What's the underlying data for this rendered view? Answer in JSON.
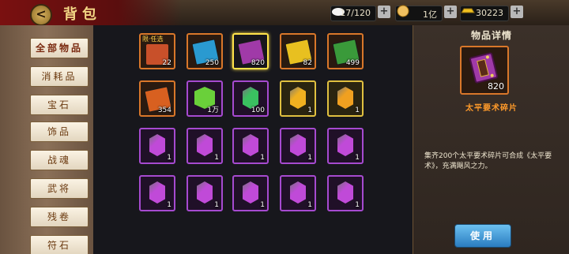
{
  "header": {
    "back_label": "<",
    "title": "背包",
    "bag_capacity": "17/120",
    "silver": "1亿",
    "gold": "30223",
    "plus_label": "+"
  },
  "sidebar": {
    "items": [
      {
        "label": "全部物品"
      },
      {
        "label": "消耗品"
      },
      {
        "label": "宝石"
      },
      {
        "label": "饰品"
      },
      {
        "label": "战魂"
      },
      {
        "label": "武将"
      },
      {
        "label": "残卷"
      },
      {
        "label": "符石"
      }
    ]
  },
  "grid": {
    "items": [
      {
        "qty": "22",
        "tag": "限·任选",
        "kind": "chest",
        "rarity": "orange"
      },
      {
        "qty": "250",
        "kind": "book",
        "rarity": "orange",
        "color": "#2a9ad0"
      },
      {
        "qty": "820",
        "kind": "book",
        "rarity": "selected",
        "color": "#a03aa8"
      },
      {
        "qty": "82",
        "kind": "book",
        "rarity": "orange",
        "color": "#e8c020"
      },
      {
        "qty": "499",
        "kind": "book",
        "rarity": "orange",
        "color": "#3a9a3a"
      },
      {
        "qty": "354",
        "kind": "book",
        "rarity": "orange",
        "color": "#d86020"
      },
      {
        "qty": "1万",
        "kind": "herb",
        "rarity": "purple",
        "color": "#6ad03a"
      },
      {
        "qty": "100",
        "kind": "gem",
        "rarity": "purple",
        "color": "#3ac060"
      },
      {
        "qty": "1",
        "kind": "gem",
        "rarity": "gold",
        "color": "#f0b020"
      },
      {
        "qty": "1",
        "kind": "gem",
        "rarity": "gold",
        "color": "#f0a020"
      },
      {
        "qty": "1",
        "kind": "gem",
        "rarity": "purple",
        "color": "#c04ad8"
      },
      {
        "qty": "1",
        "kind": "gem",
        "rarity": "purple",
        "color": "#c04ad8"
      },
      {
        "qty": "1",
        "kind": "gem",
        "rarity": "purple",
        "color": "#c04ad8"
      },
      {
        "qty": "1",
        "kind": "gem",
        "rarity": "purple",
        "color": "#c04ad8"
      },
      {
        "qty": "1",
        "kind": "gem",
        "rarity": "purple",
        "color": "#c04ad8"
      },
      {
        "qty": "1",
        "kind": "gem",
        "rarity": "purple",
        "color": "#c04ad8"
      },
      {
        "qty": "1",
        "kind": "gem",
        "rarity": "purple",
        "color": "#c04ad8"
      },
      {
        "qty": "1",
        "kind": "gem",
        "rarity": "purple",
        "color": "#c04ad8"
      },
      {
        "qty": "1",
        "kind": "gem",
        "rarity": "purple",
        "color": "#c04ad8"
      },
      {
        "qty": "1",
        "kind": "gem",
        "rarity": "purple",
        "color": "#c04ad8"
      }
    ]
  },
  "detail": {
    "heading": "物品详情",
    "qty": "820",
    "name": "太平要术碎片",
    "description": "集齐200个太平要术碎片可合成《太平要术》，充满飓风之力。",
    "use_label": "使用"
  },
  "colors": {
    "title_bar": "#7a1010",
    "title_text": "#f3d685",
    "item_name": "#ff9a2a",
    "use_button": "#2a7cc0"
  },
  "icons": {
    "back": "back-arrow-icon",
    "bag_capacity": "rice-bowl-icon",
    "silver": "silver-coin-icon",
    "gold": "gold-ingot-icon"
  }
}
